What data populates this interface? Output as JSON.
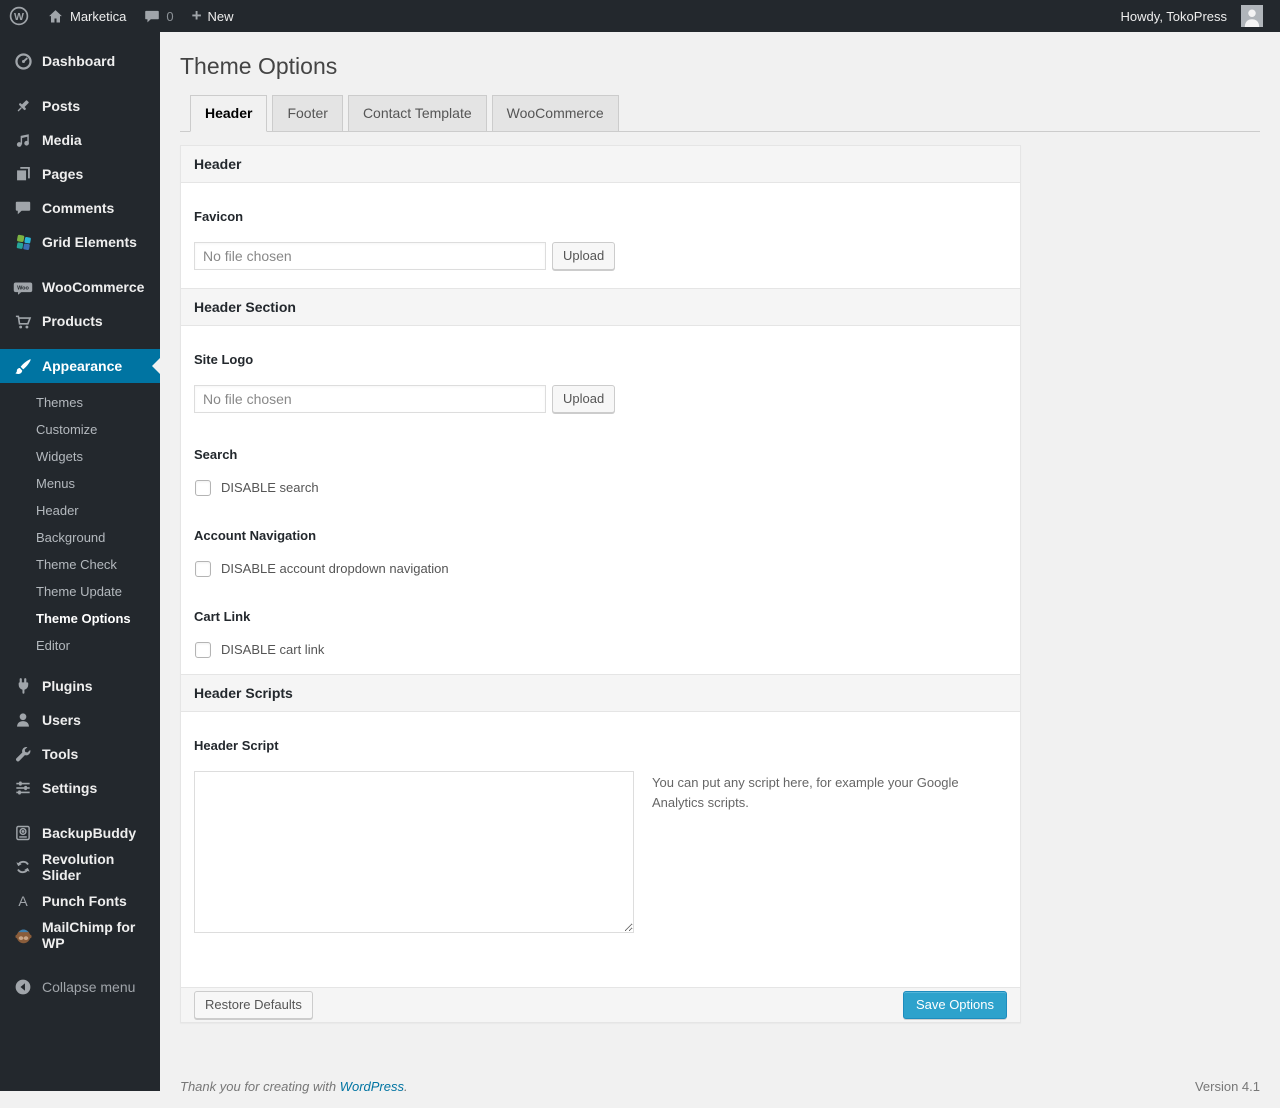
{
  "adminbar": {
    "site_name": "Marketica",
    "comments_count": "0",
    "new_label": "New",
    "howdy": "Howdy, TokoPress"
  },
  "sidebar": {
    "items": [
      {
        "id": "dashboard",
        "icon": "dashboard-icon",
        "label": "Dashboard"
      },
      {
        "type": "separator"
      },
      {
        "id": "posts",
        "icon": "pin-icon",
        "label": "Posts"
      },
      {
        "id": "media",
        "icon": "media-icon",
        "label": "Media"
      },
      {
        "id": "pages",
        "icon": "pages-icon",
        "label": "Pages"
      },
      {
        "id": "comments",
        "icon": "comments-icon",
        "label": "Comments"
      },
      {
        "id": "grid-elements",
        "icon": "grid-elements-icon",
        "label": "Grid Elements"
      },
      {
        "type": "separator"
      },
      {
        "id": "woocommerce",
        "icon": "woocommerce-icon",
        "label": "WooCommerce"
      },
      {
        "id": "products",
        "icon": "cart-icon",
        "label": "Products"
      },
      {
        "type": "separator"
      },
      {
        "id": "appearance",
        "icon": "appearance-icon",
        "label": "Appearance",
        "active": true,
        "submenu": [
          {
            "id": "themes",
            "label": "Themes"
          },
          {
            "id": "customize",
            "label": "Customize"
          },
          {
            "id": "widgets",
            "label": "Widgets"
          },
          {
            "id": "menus",
            "label": "Menus"
          },
          {
            "id": "header",
            "label": "Header"
          },
          {
            "id": "background",
            "label": "Background"
          },
          {
            "id": "theme-check",
            "label": "Theme Check"
          },
          {
            "id": "theme-update",
            "label": "Theme Update"
          },
          {
            "id": "theme-options",
            "label": "Theme Options",
            "current": true
          },
          {
            "id": "editor",
            "label": "Editor"
          }
        ]
      },
      {
        "id": "plugins",
        "icon": "plugin-icon",
        "label": "Plugins"
      },
      {
        "id": "users",
        "icon": "users-icon",
        "label": "Users"
      },
      {
        "id": "tools",
        "icon": "wrench-icon",
        "label": "Tools"
      },
      {
        "id": "settings",
        "icon": "settings-icon",
        "label": "Settings"
      },
      {
        "type": "separator"
      },
      {
        "id": "backupbuddy",
        "icon": "backup-icon",
        "label": "BackupBuddy"
      },
      {
        "id": "revolution-slider",
        "icon": "sync-icon",
        "label": "Revolution Slider"
      },
      {
        "id": "punch-fonts",
        "icon": "letter-a-icon",
        "label": "Punch Fonts"
      },
      {
        "id": "mailchimp",
        "icon": "mailchimp-icon",
        "label": "MailChimp for WP"
      },
      {
        "type": "separator",
        "size": "large"
      },
      {
        "id": "collapse-menu",
        "icon": "collapse-icon",
        "label": "Collapse menu",
        "muted": true
      }
    ]
  },
  "page": {
    "title": "Theme Options",
    "tabs": [
      {
        "id": "header",
        "label": "Header",
        "active": true
      },
      {
        "id": "footer",
        "label": "Footer"
      },
      {
        "id": "contact-template",
        "label": "Contact Template"
      },
      {
        "id": "woocommerce",
        "label": "WooCommerce"
      }
    ]
  },
  "panel": {
    "sections": [
      {
        "type": "title",
        "id": "header",
        "text": "Header"
      },
      {
        "type": "upload",
        "id": "favicon",
        "label": "Favicon",
        "placeholder": "No file chosen",
        "button": "Upload"
      },
      {
        "type": "title",
        "id": "header-section",
        "text": "Header Section"
      },
      {
        "type": "upload",
        "id": "site-logo",
        "label": "Site Logo",
        "placeholder": "No file chosen",
        "button": "Upload"
      },
      {
        "type": "checkbox",
        "id": "search",
        "label": "Search",
        "text": "DISABLE search",
        "checked": false
      },
      {
        "type": "checkbox",
        "id": "account-navigation",
        "label": "Account Navigation",
        "text": "DISABLE account dropdown navigation",
        "checked": false
      },
      {
        "type": "checkbox",
        "id": "cart-link",
        "label": "Cart Link",
        "text": "DISABLE cart link",
        "checked": false
      },
      {
        "type": "title",
        "id": "header-scripts",
        "text": "Header Scripts"
      },
      {
        "type": "textarea",
        "id": "header-script",
        "label": "Header Script",
        "value": "",
        "help": "You can put any script here, for example your Google Analytics scripts."
      }
    ],
    "buttons": {
      "restore": "Restore Defaults",
      "save": "Save Options"
    }
  },
  "footer": {
    "credit_prefix": "Thank you for creating with ",
    "credit_link": "WordPress",
    "credit_suffix": ".",
    "version": "Version 4.1"
  },
  "colors": {
    "accent": "#0074a2",
    "primary_button": "#2ea2cc",
    "adminbar_bg": "#23282d",
    "page_bg": "#f1f1f1"
  }
}
